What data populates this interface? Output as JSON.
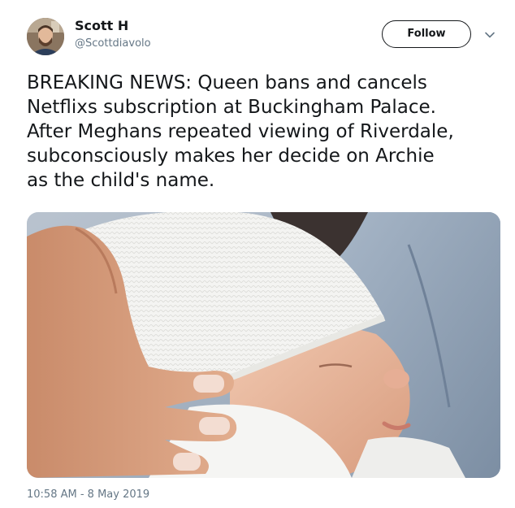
{
  "author": {
    "display_name": "Scott H",
    "handle": "@Scottdiavolo"
  },
  "actions": {
    "follow_label": "Follow",
    "more_icon": "chevron-down-icon"
  },
  "tweet": {
    "text": "BREAKING NEWS: Queen bans and cancels\nNetflixs subscription at Buckingham Palace.\nAfter Meghans repeated viewing of Riverdale,\nsubconsciously makes her decide on Archie\nas the child's name.",
    "timestamp": "10:58 AM - 8 May 2019"
  },
  "colors": {
    "text_primary": "#14171a",
    "text_secondary": "#657786",
    "background": "#ffffff"
  }
}
